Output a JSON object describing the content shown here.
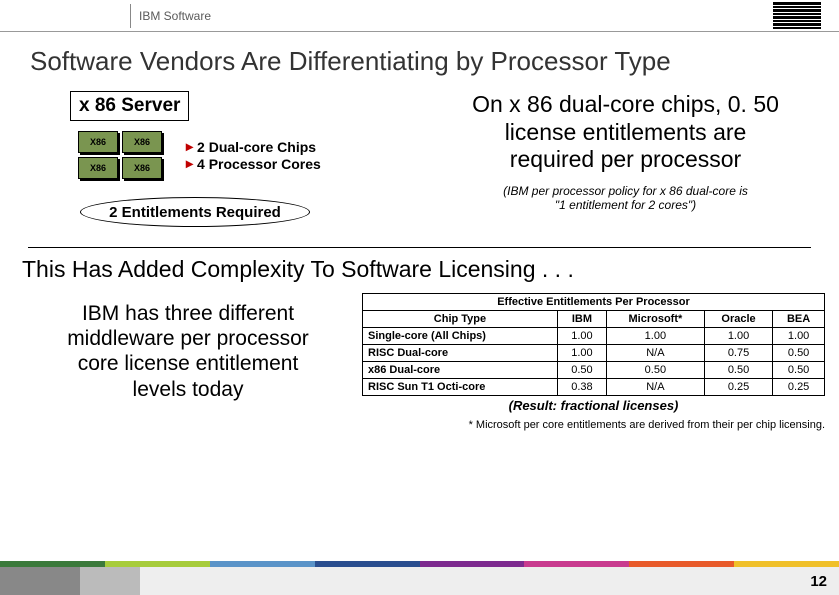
{
  "header": {
    "brand": "IBM Software"
  },
  "title": "Software Vendors Are Differentiating by Processor Type",
  "server": {
    "label": "x 86 Server",
    "chip_label": "X86",
    "bullet1": "2 Dual-core Chips",
    "bullet2": "4 Processor Cores",
    "entitlements": "2 Entitlements Required"
  },
  "callout": {
    "line1": "On x 86 dual-core chips, 0. 50",
    "line2": "license entitlements are",
    "line3": "required per processor",
    "note1": "(IBM per processor policy for x 86 dual-core is",
    "note2": "\"1 entitlement for 2 cores\")"
  },
  "title2": "This Has Added Complexity To Software Licensing . . .",
  "middleware": {
    "line1": "IBM has three different",
    "line2": "middleware per processor",
    "line3": "core license entitlement",
    "line4": "levels today"
  },
  "table": {
    "caption": "Effective Entitlements Per Processor",
    "head0": "Chip Type",
    "head1": "IBM",
    "head2": "Microsoft*",
    "head3": "Oracle",
    "head4": "BEA",
    "rows": [
      {
        "label": "Single-core (All Chips)",
        "c1": "1.00",
        "c2": "1.00",
        "c3": "1.00",
        "c4": "1.00"
      },
      {
        "label": "RISC Dual-core",
        "c1": "1.00",
        "c2": "N/A",
        "c3": "0.75",
        "c4": "0.50"
      },
      {
        "label": "x86 Dual-core",
        "c1": "0.50",
        "c2": "0.50",
        "c3": "0.50",
        "c4": "0.50"
      },
      {
        "label": "RISC Sun T1 Octi-core",
        "c1": "0.38",
        "c2": "N/A",
        "c3": "0.25",
        "c4": "0.25"
      }
    ],
    "result": "(Result: fractional licenses)"
  },
  "footnote": "* Microsoft per core entitlements are derived from their per chip licensing.",
  "page": "12",
  "rainbow": [
    "#3b7a3b",
    "#a7cc3b",
    "#5a93c8",
    "#2a4e8f",
    "#7d2a8f",
    "#c93b8f",
    "#e85a2a",
    "#f0c02a"
  ]
}
